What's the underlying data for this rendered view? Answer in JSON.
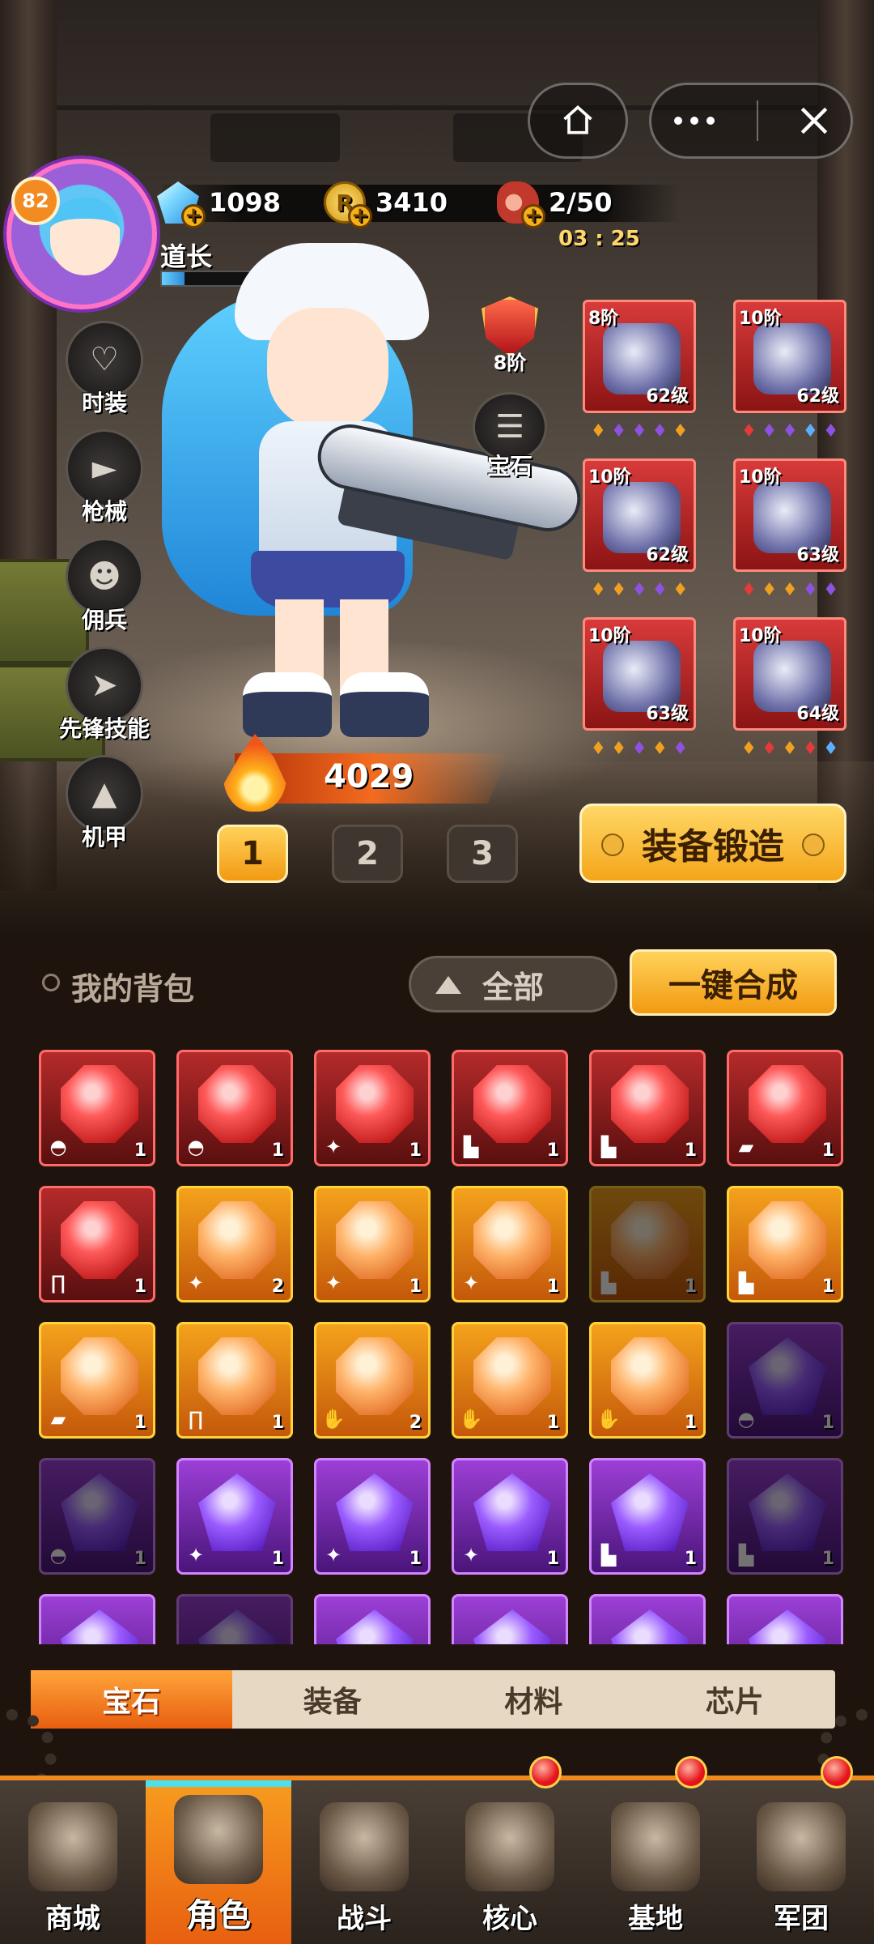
{
  "top_bar": {
    "home_icon": "home-icon",
    "more_icon": "more-dots-icon",
    "close_icon": "close-icon"
  },
  "player": {
    "level": "82",
    "name": "道长",
    "exp_fraction": 0.1
  },
  "currencies": {
    "gems": "1098",
    "coins": "3410",
    "coin_symbol": "R",
    "stamina": "2/50",
    "stamina_timer": "03 : 25"
  },
  "side_menu": [
    {
      "label": "时装",
      "icon": "outfit-icon"
    },
    {
      "label": "枪械",
      "icon": "pistol-icon"
    },
    {
      "label": "佣兵",
      "icon": "mercenary-icon"
    },
    {
      "label": "先锋技能",
      "icon": "vanguard-skill-icon"
    },
    {
      "label": "机甲",
      "icon": "mecha-icon"
    }
  ],
  "rank": {
    "label": "8阶"
  },
  "gem_button": {
    "label": "宝石"
  },
  "equipment": [
    {
      "tier": "8阶",
      "level": "62级",
      "dots": [
        "#f0a020",
        "#8e52e0",
        "#8e52e0",
        "#8e52e0",
        "#f0a020"
      ]
    },
    {
      "tier": "10阶",
      "level": "62级",
      "dots": [
        "#e33a3a",
        "#8e52e0",
        "#8e52e0",
        "#5ab0ff",
        "#8e52e0"
      ]
    },
    {
      "tier": "10阶",
      "level": "62级",
      "dots": [
        "#f0a020",
        "#f0a020",
        "#8e52e0",
        "#8e52e0",
        "#f0a020"
      ]
    },
    {
      "tier": "10阶",
      "level": "63级",
      "dots": [
        "#e33a3a",
        "#f0a020",
        "#f0a020",
        "#8e52e0",
        "#8e52e0"
      ]
    },
    {
      "tier": "10阶",
      "level": "63级",
      "dots": [
        "#f0a020",
        "#f0a020",
        "#8e52e0",
        "#f0a020",
        "#8e52e0"
      ]
    },
    {
      "tier": "10阶",
      "level": "64级",
      "dots": [
        "#f0a020",
        "#e33a3a",
        "#f0a020",
        "#e33a3a",
        "#5ab0ff"
      ]
    }
  ],
  "power": {
    "value": "4029"
  },
  "loadout_slots": [
    "1",
    "2",
    "3"
  ],
  "forge_button": {
    "label": "装备锻造"
  },
  "backpack": {
    "title": "我的背包",
    "filter": "全部",
    "merge_button": "一键合成",
    "items": [
      {
        "color": "red",
        "shape": "hex",
        "slot": "◓",
        "count": "1",
        "dim": false
      },
      {
        "color": "red",
        "shape": "hex",
        "slot": "◓",
        "count": "1",
        "dim": false
      },
      {
        "color": "red",
        "shape": "hex",
        "slot": "✦",
        "count": "1",
        "dim": false
      },
      {
        "color": "red",
        "shape": "hex",
        "slot": "▙",
        "count": "1",
        "dim": false
      },
      {
        "color": "red",
        "shape": "hex",
        "slot": "▙",
        "count": "1",
        "dim": false
      },
      {
        "color": "red",
        "shape": "hex",
        "slot": "▰",
        "count": "1",
        "dim": false
      },
      {
        "color": "red",
        "shape": "hex",
        "slot": "∏",
        "count": "1",
        "dim": false
      },
      {
        "color": "orange",
        "shape": "hex",
        "slot": "✦",
        "count": "2",
        "dim": false
      },
      {
        "color": "orange",
        "shape": "hex",
        "slot": "✦",
        "count": "1",
        "dim": false
      },
      {
        "color": "orange",
        "shape": "hex",
        "slot": "✦",
        "count": "1",
        "dim": false
      },
      {
        "color": "orange",
        "shape": "hex",
        "slot": "▙",
        "count": "1",
        "dim": true
      },
      {
        "color": "orange",
        "shape": "hex",
        "slot": "▙",
        "count": "1",
        "dim": false
      },
      {
        "color": "orange",
        "shape": "hex",
        "slot": "▰",
        "count": "1",
        "dim": false
      },
      {
        "color": "orange",
        "shape": "hex",
        "slot": "∏",
        "count": "1",
        "dim": false
      },
      {
        "color": "orange",
        "shape": "hex",
        "slot": "✋",
        "count": "2",
        "dim": false
      },
      {
        "color": "orange",
        "shape": "hex",
        "slot": "✋",
        "count": "1",
        "dim": false
      },
      {
        "color": "orange",
        "shape": "hex",
        "slot": "✋",
        "count": "1",
        "dim": false
      },
      {
        "color": "purple",
        "shape": "pent",
        "slot": "◓",
        "count": "1",
        "dim": true
      },
      {
        "color": "purple",
        "shape": "pent",
        "slot": "◓",
        "count": "1",
        "dim": true
      },
      {
        "color": "purple",
        "shape": "pent",
        "slot": "✦",
        "count": "1",
        "dim": false
      },
      {
        "color": "purple",
        "shape": "pent",
        "slot": "✦",
        "count": "1",
        "dim": false
      },
      {
        "color": "purple",
        "shape": "pent",
        "slot": "✦",
        "count": "1",
        "dim": false
      },
      {
        "color": "purple",
        "shape": "pent",
        "slot": "▙",
        "count": "1",
        "dim": false
      },
      {
        "color": "purple",
        "shape": "pent",
        "slot": "▙",
        "count": "1",
        "dim": true
      },
      {
        "color": "purple",
        "shape": "pent",
        "slot": "",
        "count": "",
        "dim": false
      },
      {
        "color": "purple",
        "shape": "pent",
        "slot": "",
        "count": "",
        "dim": true
      },
      {
        "color": "purple",
        "shape": "pent",
        "slot": "",
        "count": "",
        "dim": false
      },
      {
        "color": "purple",
        "shape": "pent",
        "slot": "",
        "count": "",
        "dim": false
      },
      {
        "color": "purple",
        "shape": "pent",
        "slot": "",
        "count": "",
        "dim": false
      },
      {
        "color": "purple",
        "shape": "pent",
        "slot": "",
        "count": "",
        "dim": false
      }
    ]
  },
  "category_tabs": [
    {
      "label": "宝石",
      "active": true
    },
    {
      "label": "装备",
      "active": false
    },
    {
      "label": "材料",
      "active": false
    },
    {
      "label": "芯片",
      "active": false
    }
  ],
  "bottom_nav": [
    {
      "label": "商城",
      "icon": "shop-icon",
      "active": false,
      "alert": false
    },
    {
      "label": "角色",
      "icon": "character-icon",
      "active": true,
      "alert": false
    },
    {
      "label": "战斗",
      "icon": "battle-icon",
      "active": false,
      "alert": false
    },
    {
      "label": "核心",
      "icon": "core-icon",
      "active": false,
      "alert": true
    },
    {
      "label": "基地",
      "icon": "base-icon",
      "active": false,
      "alert": true
    },
    {
      "label": "军团",
      "icon": "legion-icon",
      "active": false,
      "alert": true
    }
  ]
}
